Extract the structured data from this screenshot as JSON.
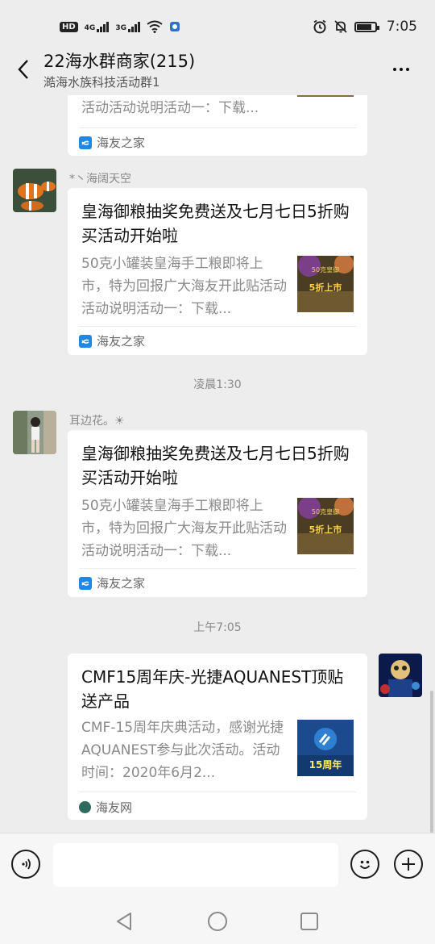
{
  "status_bar": {
    "hd": "HD",
    "sim1_gen": "4G",
    "sim2_gen": "3G",
    "time": "7:05",
    "icons": [
      "signal-icon",
      "wifi-icon",
      "alarm-icon",
      "mute-icon",
      "battery-icon"
    ]
  },
  "header": {
    "title": "22海水群商家(215)",
    "subtitle": "澔海水族科技活动群1"
  },
  "messages": [
    {
      "desc_partial": "活动活动说明活动一：下载...",
      "source": "海友之家"
    },
    {
      "sender": "*丶海阔天空",
      "title": "皇海御粮抽奖免费送及七月七日5折购买活动开始啦",
      "desc": "50克小罐装皇海手工粮即将上市，特为回报广大海友开此贴活动活动说明活动一：下载...",
      "source": "海友之家",
      "thumb_text": "5折上市"
    },
    {
      "timestamp": "凌晨1:30"
    },
    {
      "sender": "耳边花。☀",
      "title": "皇海御粮抽奖免费送及七月七日5折购买活动开始啦",
      "desc": "50克小罐装皇海手工粮即将上市，特为回报广大海友开此贴活动活动说明活动一：下载...",
      "source": "海友之家",
      "thumb_text": "5折上市"
    },
    {
      "timestamp": "上午7:05"
    },
    {
      "title": "CMF15周年庆-光捷AQUANEST顶贴送产品",
      "desc": "CMF-15周年庆典活动，感谢光捷AQUANEST参与此次活动。活动时间：2020年6月2...",
      "source": "海友网",
      "thumb_text": "15周年"
    }
  ],
  "input": {
    "placeholder": ""
  },
  "colors": {
    "background": "#ededed",
    "card": "#ffffff",
    "muted_text": "#8a8a8a",
    "source_icon_blue": "#1e88e5"
  }
}
